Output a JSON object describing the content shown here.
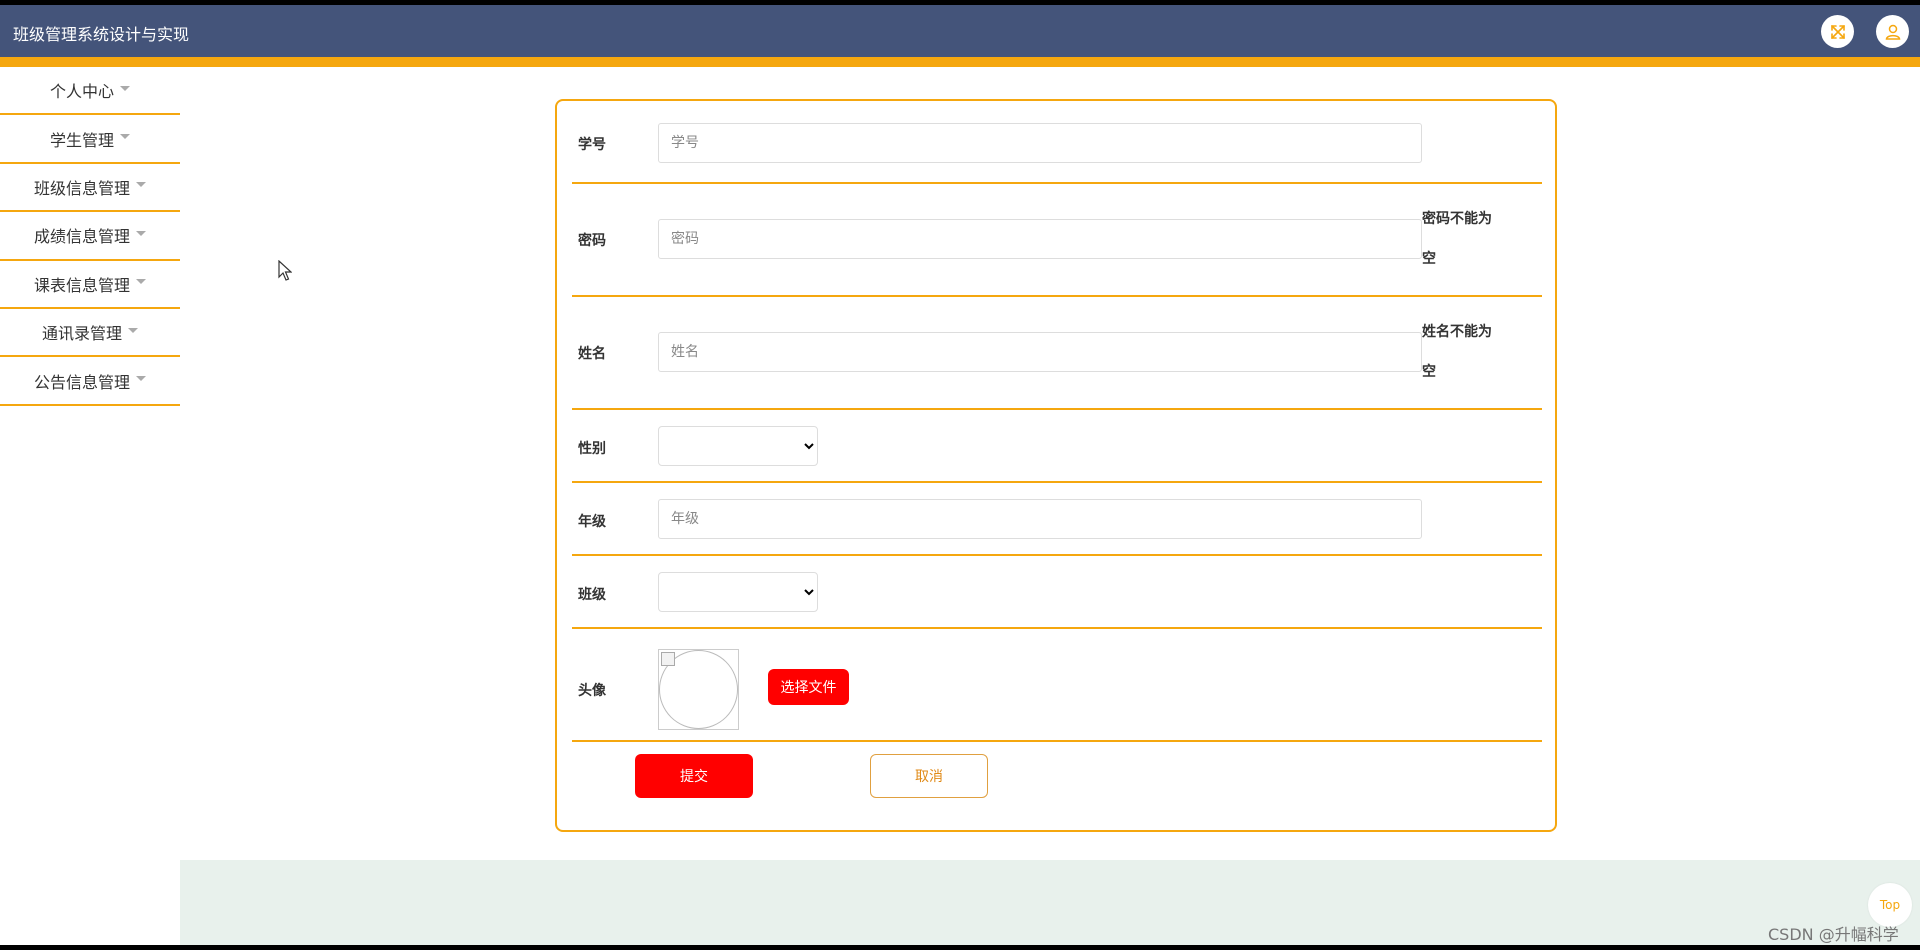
{
  "header": {
    "title": "班级管理系统设计与实现",
    "fullscreen_icon": "expand-arrows-icon",
    "user_icon": "user-icon"
  },
  "sidebar": {
    "items": [
      {
        "label": "个人中心"
      },
      {
        "label": "学生管理"
      },
      {
        "label": "班级信息管理"
      },
      {
        "label": "成绩信息管理"
      },
      {
        "label": "课表信息管理"
      },
      {
        "label": "通讯录管理"
      },
      {
        "label": "公告信息管理"
      }
    ]
  },
  "form": {
    "student_id": {
      "label": "学号",
      "placeholder": "学号",
      "value": ""
    },
    "password": {
      "label": "密码",
      "placeholder": "密码",
      "value": "",
      "error": "密码不能为空"
    },
    "name": {
      "label": "姓名",
      "placeholder": "姓名",
      "value": "",
      "error": "姓名不能为空"
    },
    "gender": {
      "label": "性别",
      "selected": ""
    },
    "grade": {
      "label": "年级",
      "placeholder": "年级",
      "value": ""
    },
    "class": {
      "label": "班级",
      "selected": ""
    },
    "avatar": {
      "label": "头像",
      "upload_label": "选择文件"
    },
    "submit_label": "提交",
    "cancel_label": "取消"
  },
  "back_to_top": "Top",
  "watermark": "CSDN @升幅科学",
  "colors": {
    "header_bg": "#44547a",
    "accent": "#f5a70f",
    "primary_button": "#ff0000",
    "footer_band": "#e8f1ec"
  }
}
